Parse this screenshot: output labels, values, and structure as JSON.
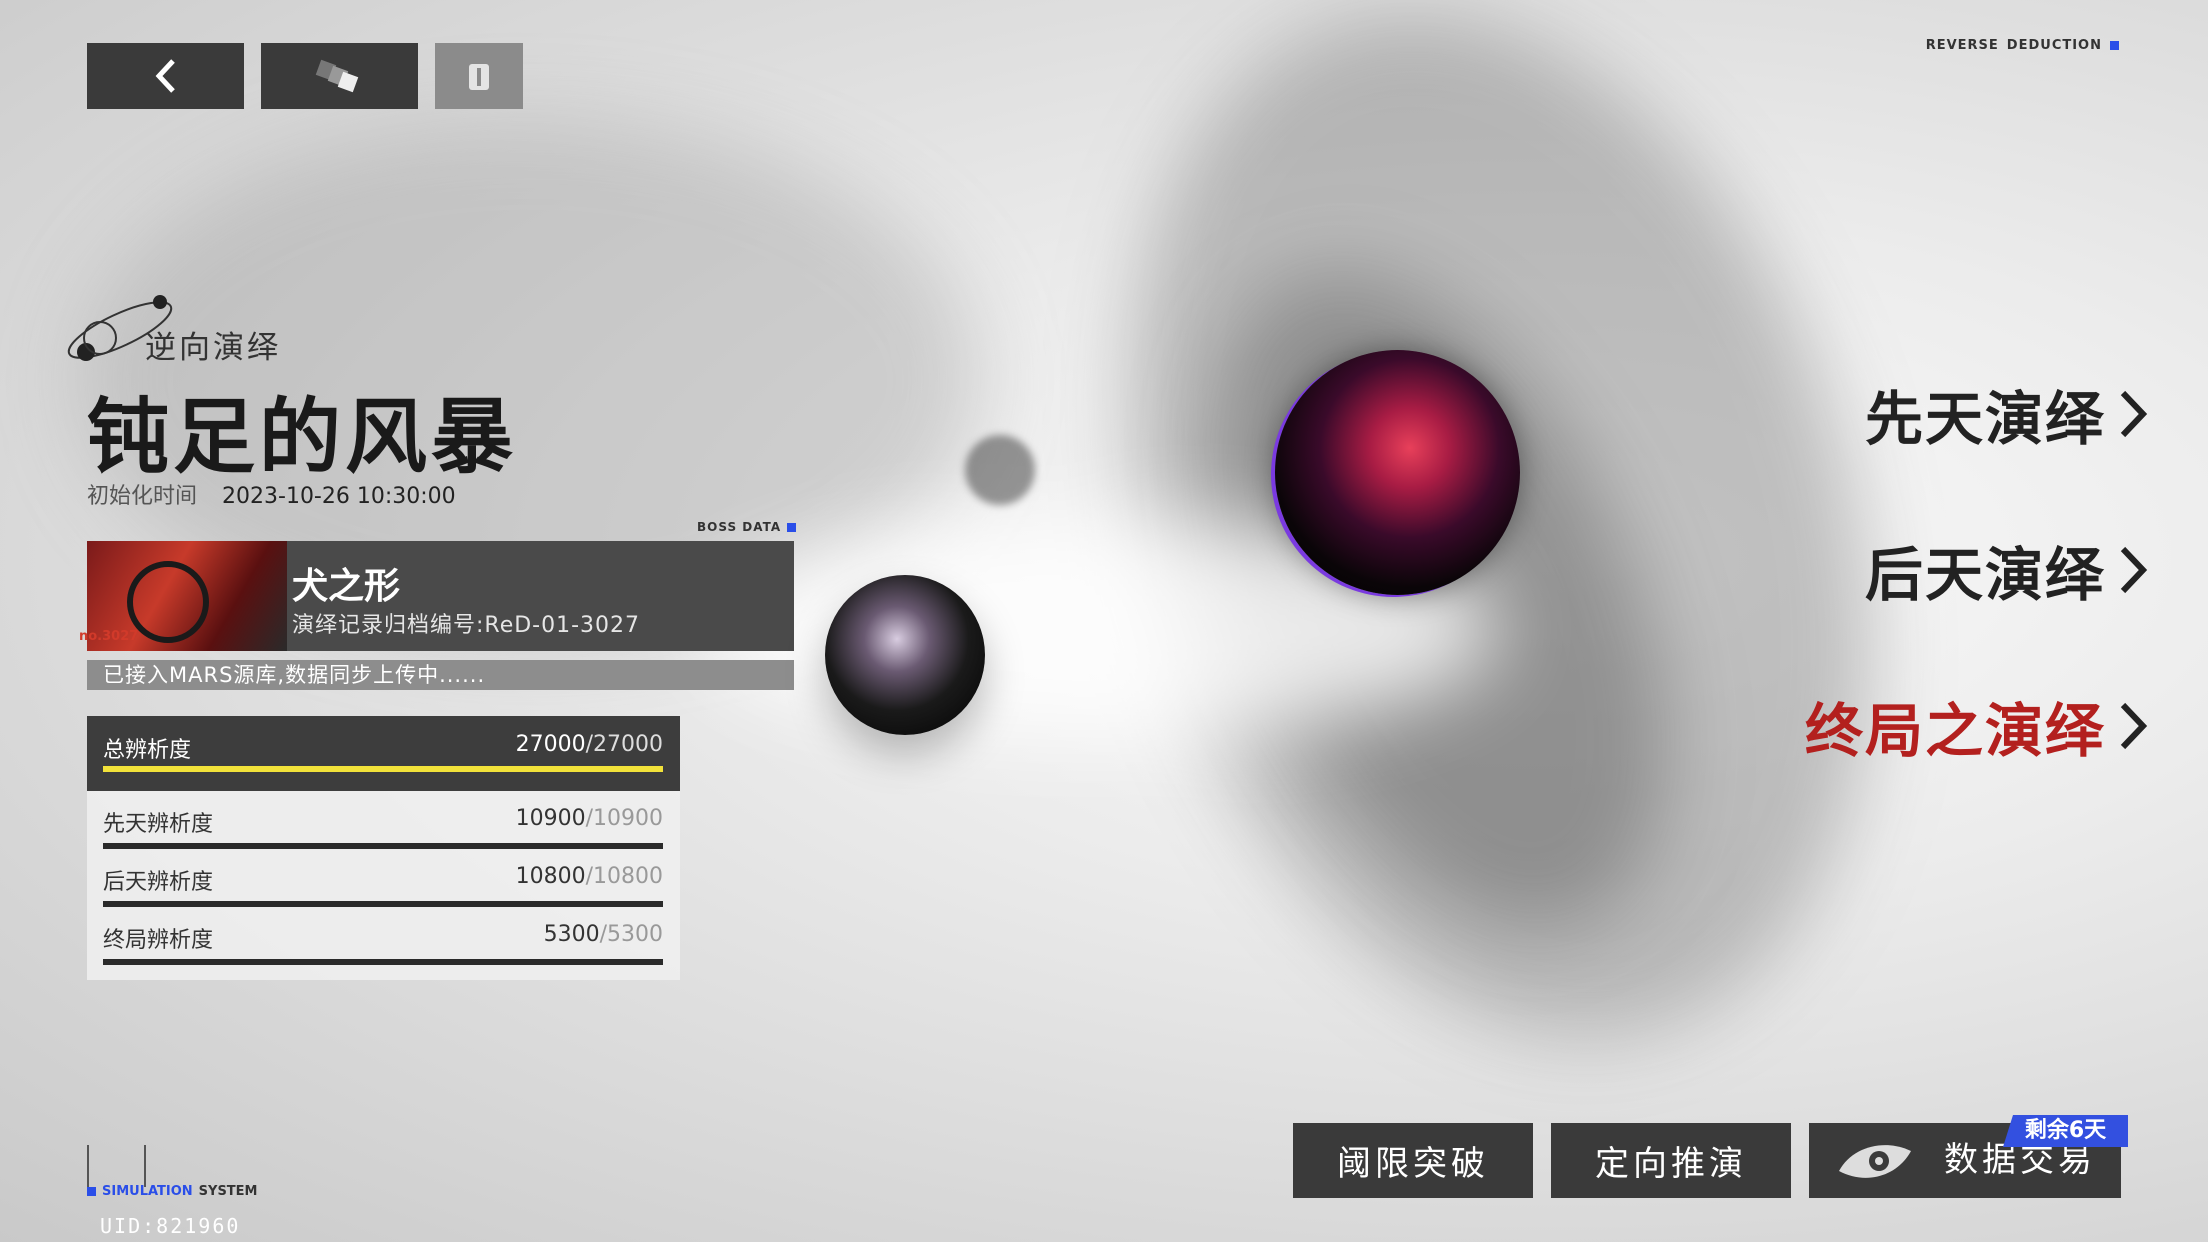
{
  "top_bar": {
    "back_icon": "chevron-left-icon",
    "cube_icon": "cubes-icon",
    "info_icon": "info-icon"
  },
  "corner_brand": {
    "left": "REVERSE",
    "right": "DEDUCTION"
  },
  "header": {
    "mode_label": "逆向演绎",
    "stage_title": "钝足的风暴",
    "init_label": "初始化时间",
    "init_time": "2023-10-26 10:30:00"
  },
  "boss": {
    "tag": "BOSS  DATA",
    "name": "犬之形",
    "archive": "演绎记录归档编号:ReD-01-3027",
    "thumb_no": "no.3027",
    "sync_status": "已接入MARS源库,数据同步上传中......"
  },
  "stats": [
    {
      "label": "总辨析度",
      "value": "27000",
      "max": "/27000",
      "progress": 1.0,
      "color": "#f2e23a"
    },
    {
      "label": "先天辨析度",
      "value": "10900",
      "max": "/10900",
      "progress": 1.0,
      "color": "#2a2a2a"
    },
    {
      "label": "后天辨析度",
      "value": "10800",
      "max": "/10800",
      "progress": 1.0,
      "color": "#2a2a2a"
    },
    {
      "label": "终局辨析度",
      "value": "5300",
      "max": "/5300",
      "progress": 1.0,
      "color": "#2a2a2a"
    }
  ],
  "deductions": [
    {
      "label": "先天演绎",
      "active": false
    },
    {
      "label": "后天演绎",
      "active": false
    },
    {
      "label": "终局之演绎",
      "active": true
    }
  ],
  "bottom_buttons": {
    "threshold": "阈限突破",
    "directed": "定向推演",
    "trade": "数据交易",
    "trade_badge": "剩余6天"
  },
  "footer": {
    "sim_left": "SIMULATION",
    "sim_right": "SYSTEM",
    "uid": "UID:821960"
  },
  "colors": {
    "accent_red": "#b3201e",
    "badge_blue": "#3350e0",
    "progress_yellow": "#f2e23a"
  }
}
